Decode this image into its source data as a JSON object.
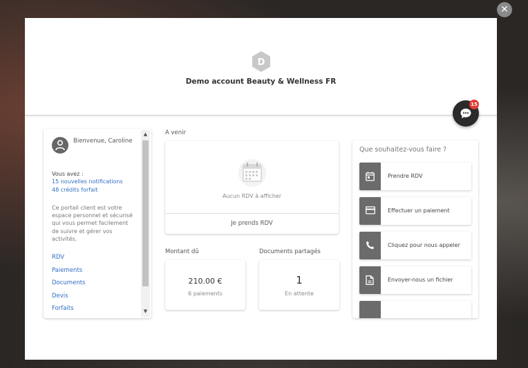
{
  "brand": {
    "logo_letter": "D",
    "account_name": "Demo account Beauty & Wellness FR"
  },
  "chat": {
    "badge_count": "15"
  },
  "close_label": "✕",
  "sidebar": {
    "welcome": "Bienvenue, Caroline",
    "vous_avez": "Vous avez :",
    "notifications": "15 nouvelles notifications",
    "credits": "48 crédits forfait",
    "description": "Ce portail client est votre espace personnel et sécurisé qui vous permet facilement de suivre et gérer vos activités.",
    "nav": [
      "RDV",
      "Paiements",
      "Documents",
      "Devis",
      "Forfaits"
    ]
  },
  "upcoming": {
    "label": "A venir",
    "empty_text": "Aucun RDV à afficher",
    "book_button": "Je prends RDV"
  },
  "amount_due": {
    "label": "Montant dû",
    "value": "210.00 €",
    "sub": "6 paiements"
  },
  "shared_docs": {
    "label": "Documents partagés",
    "value": "1",
    "sub": "En attente"
  },
  "actions": {
    "title": "Que souhaitez-vous faire ?",
    "items": [
      {
        "label": "Prendre RDV",
        "icon": "calendar-icon"
      },
      {
        "label": "Effectuer un paiement",
        "icon": "credit-card-icon"
      },
      {
        "label": "Cliquez pour nous appeler",
        "icon": "phone-icon"
      },
      {
        "label": "Envoyer-nous un fichier",
        "icon": "file-icon"
      }
    ]
  },
  "colors": {
    "link": "#2f6ec3",
    "badge": "#e53935",
    "action_square": "#6b6b6b"
  }
}
